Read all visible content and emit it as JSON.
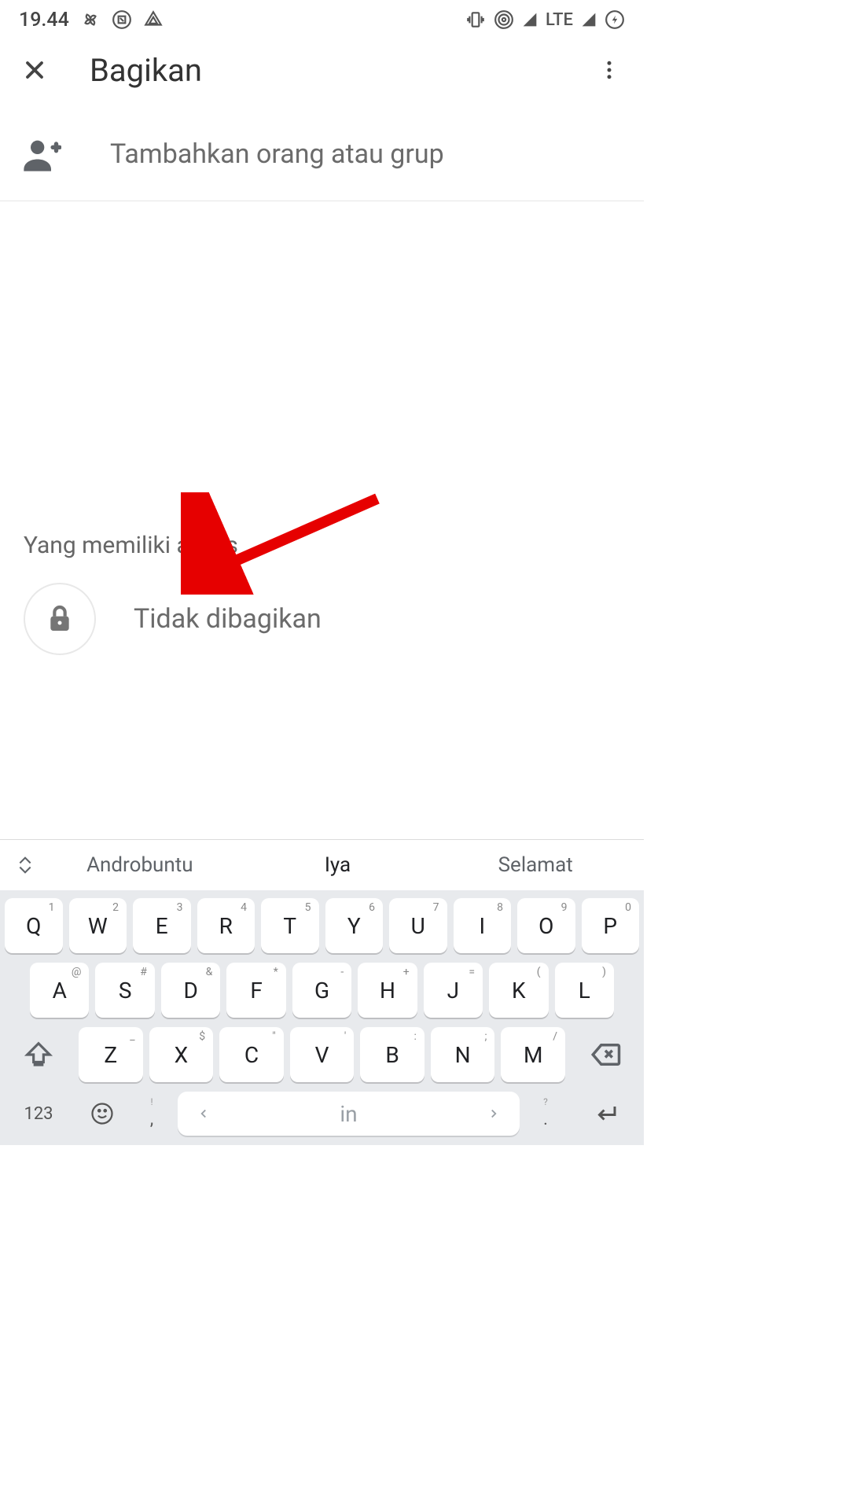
{
  "status": {
    "time": "19.44",
    "network_label": "LTE"
  },
  "header": {
    "title": "Bagikan"
  },
  "input": {
    "placeholder": "Tambahkan orang atau grup"
  },
  "access": {
    "title": "Yang memiliki akses",
    "state": "Tidak dibagikan"
  },
  "keyboard": {
    "suggestions": [
      "Androbuntu",
      "Iya",
      "Selamat"
    ],
    "row1": [
      {
        "main": "Q",
        "hint": "1"
      },
      {
        "main": "W",
        "hint": "2"
      },
      {
        "main": "E",
        "hint": "3"
      },
      {
        "main": "R",
        "hint": "4"
      },
      {
        "main": "T",
        "hint": "5"
      },
      {
        "main": "Y",
        "hint": "6"
      },
      {
        "main": "U",
        "hint": "7"
      },
      {
        "main": "I",
        "hint": "8"
      },
      {
        "main": "O",
        "hint": "9"
      },
      {
        "main": "P",
        "hint": "0"
      }
    ],
    "row2": [
      {
        "main": "A",
        "hint": "@"
      },
      {
        "main": "S",
        "hint": "#"
      },
      {
        "main": "D",
        "hint": "&"
      },
      {
        "main": "F",
        "hint": "*"
      },
      {
        "main": "G",
        "hint": "-"
      },
      {
        "main": "H",
        "hint": "+"
      },
      {
        "main": "J",
        "hint": "="
      },
      {
        "main": "K",
        "hint": "("
      },
      {
        "main": "L",
        "hint": ")"
      }
    ],
    "row3": [
      {
        "main": "Z",
        "hint": "_"
      },
      {
        "main": "X",
        "hint": "$"
      },
      {
        "main": "C",
        "hint": "\""
      },
      {
        "main": "V",
        "hint": "'"
      },
      {
        "main": "B",
        "hint": ":"
      },
      {
        "main": "N",
        "hint": ";"
      },
      {
        "main": "M",
        "hint": "/"
      }
    ],
    "numeric_label": "123",
    "space_label": "in",
    "comma_hint": "!",
    "dot_hint": "?"
  }
}
